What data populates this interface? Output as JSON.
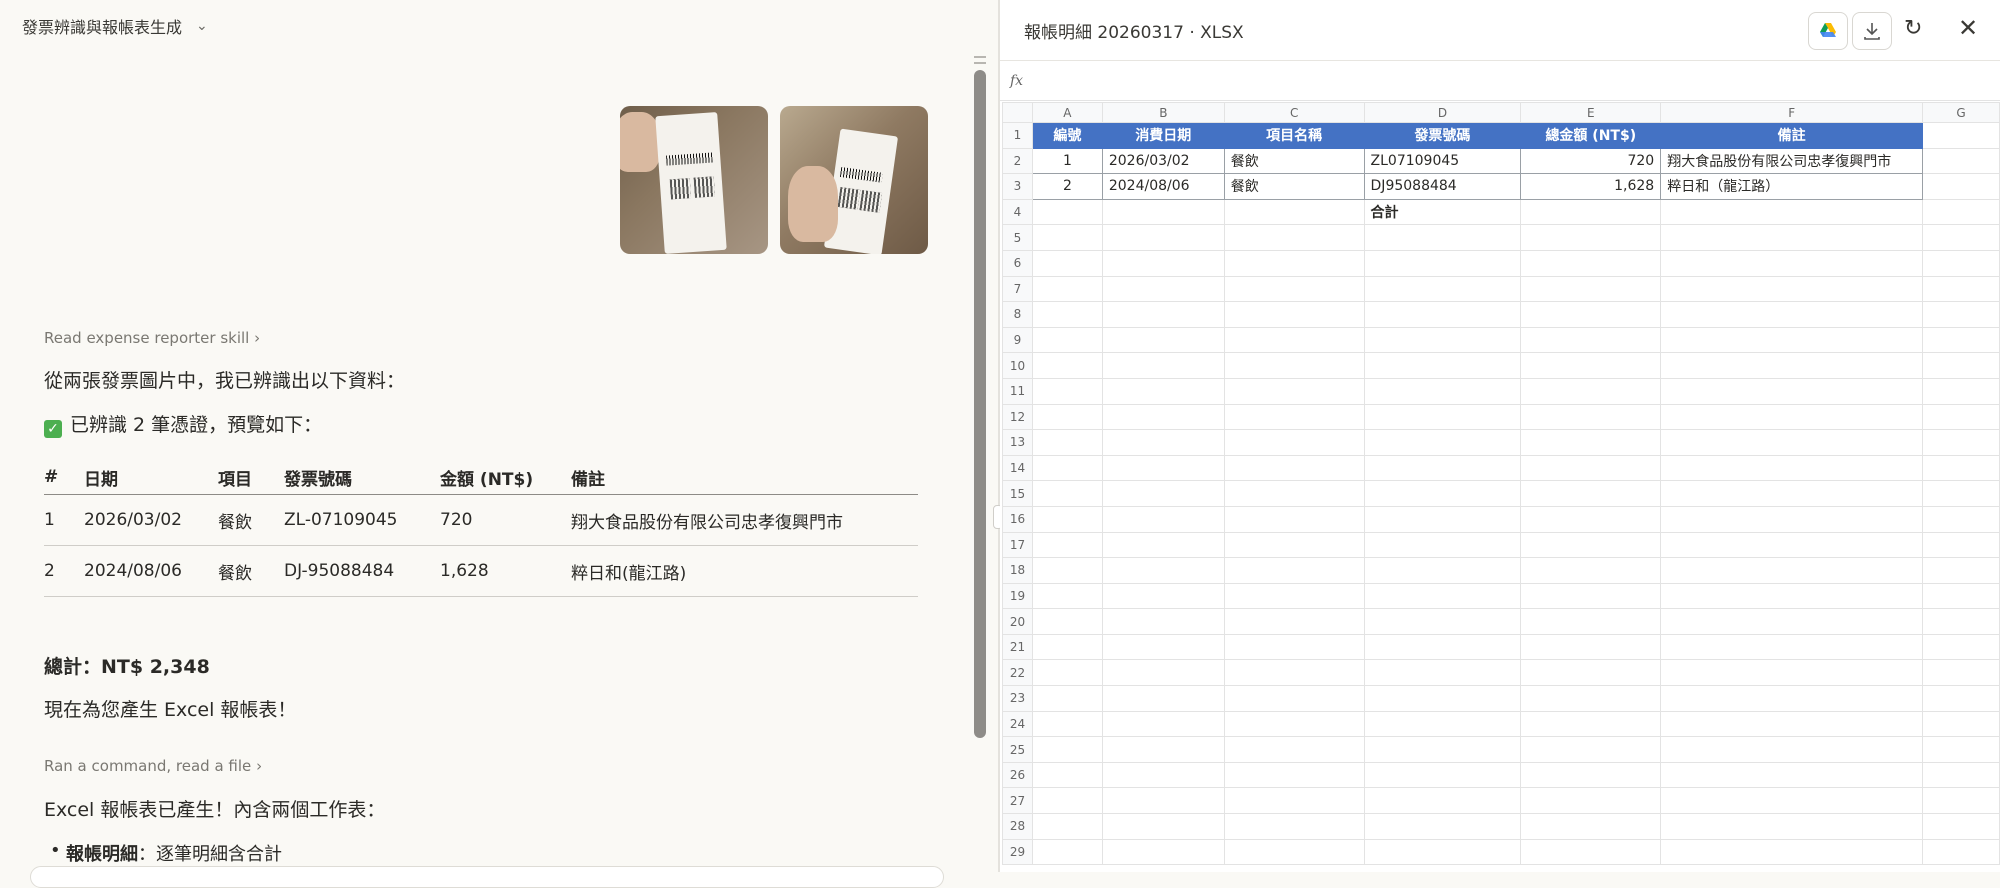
{
  "left": {
    "chat_title": "發票辨識與報帳表生成",
    "tool1": "Read expense reporter skill",
    "intro": "從兩張發票圖片中，我已辨識出以下資料：",
    "status": "已辨識 2 筆憑證，預覽如下：",
    "table": {
      "headers": [
        "#",
        "日期",
        "項目",
        "發票號碼",
        "金額 (NT$)",
        "備註"
      ],
      "rows": [
        [
          "1",
          "2026/03/02",
          "餐飲",
          "ZL-07109045",
          "720",
          "翔大食品股份有限公司忠孝復興門市"
        ],
        [
          "2",
          "2024/08/06",
          "餐飲",
          "DJ-95088484",
          "1,628",
          "粹日和(龍江路)"
        ]
      ]
    },
    "total": "總計：NT$ 2,348",
    "generating": "現在為您產生 Excel 報帳表！",
    "tool2": "Ran a command, read a file",
    "done": "Excel 報帳表已產生！內含兩個工作表：",
    "bullet_bold": "報帳明細",
    "bullet_rest": "：逐筆明細含合計",
    "icons": [
      "chevron-down-icon",
      "chevron-right-icon",
      "check-icon"
    ]
  },
  "right": {
    "file_title": "報帳明細 20260317 · XLSX",
    "fx_label": "fx",
    "columns": [
      "A",
      "B",
      "C",
      "D",
      "E",
      "F",
      "G"
    ],
    "header_row": [
      "編號",
      "消費日期",
      "項目名稱",
      "發票號碼",
      "總金額 (NT$)",
      "備註"
    ],
    "data_rows": [
      [
        "1",
        "2026/03/02",
        "餐飲",
        "ZL07109045",
        "720",
        "翔大食品股份有限公司忠孝復興門市"
      ],
      [
        "2",
        "2024/08/06",
        "餐飲",
        "DJ95088484",
        "1,628",
        "粹日和（龍江路）"
      ]
    ],
    "total_label": "合計",
    "row_numbers": [
      "1",
      "2",
      "3",
      "4",
      "5",
      "6",
      "7",
      "8",
      "9",
      "10",
      "11",
      "12",
      "13",
      "14",
      "15",
      "16",
      "17",
      "18",
      "19",
      "20",
      "21",
      "22",
      "23",
      "24",
      "25",
      "26",
      "27",
      "28",
      "29"
    ],
    "icons": [
      "google-drive-icon",
      "download-icon",
      "refresh-icon",
      "close-icon"
    ],
    "colors": {
      "header_fill": "#4472c4",
      "header_text": "#ffffff"
    }
  }
}
